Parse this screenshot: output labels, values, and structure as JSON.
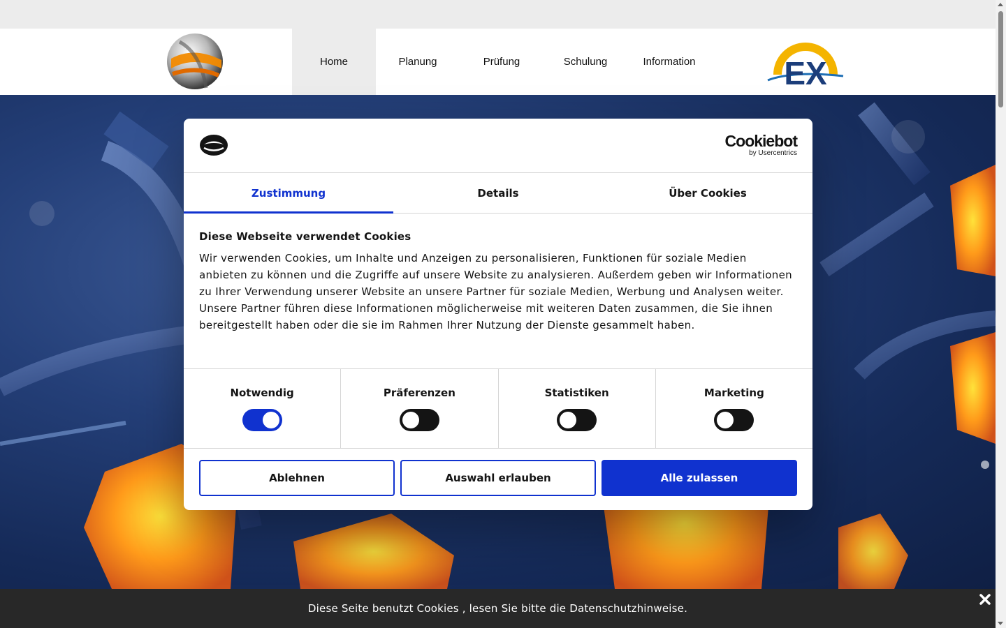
{
  "nav": {
    "items": [
      {
        "label": "Home",
        "active": true
      },
      {
        "label": "Planung",
        "active": false
      },
      {
        "label": "Prüfung",
        "active": false
      },
      {
        "label": "Schulung",
        "active": false
      },
      {
        "label": "Information",
        "active": false
      }
    ]
  },
  "logos": {
    "left": "sphere-logo",
    "right": "ex-logo",
    "right_text": "EX"
  },
  "cookie_dialog": {
    "brand_name": "Cookiebot",
    "brand_sub": "by Usercentrics",
    "tabs": [
      {
        "label": "Zustimmung",
        "active": true
      },
      {
        "label": "Details",
        "active": false
      },
      {
        "label": "Über Cookies",
        "active": false
      }
    ],
    "title": "Diese Webseite verwendet Cookies",
    "text": "Wir verwenden Cookies, um Inhalte und Anzeigen zu personalisieren, Funktionen für soziale Medien anbieten zu können und die Zugriffe auf unsere Website zu analysieren. Außerdem geben wir Informationen zu Ihrer Verwendung unserer Website an unsere Partner für soziale Medien, Werbung und Analysen weiter. Unsere Partner führen diese Informationen möglicherweise mit weiteren Daten zusammen, die Sie ihnen bereitgestellt haben oder die sie im Rahmen Ihrer Nutzung der Dienste gesammelt haben.",
    "toggles": [
      {
        "label": "Notwendig",
        "on": true
      },
      {
        "label": "Präferenzen",
        "on": false
      },
      {
        "label": "Statistiken",
        "on": false
      },
      {
        "label": "Marketing",
        "on": false
      }
    ],
    "buttons": {
      "decline": "Ablehnen",
      "allow_selection": "Auswahl erlauben",
      "allow_all": "Alle zulassen"
    }
  },
  "bottom_bar": {
    "text": "Diese Seite benutzt Cookies , lesen Sie bitte die Datenschutzhinweise."
  },
  "colors": {
    "accent": "#1032cf",
    "bottom_bar": "#282828"
  }
}
